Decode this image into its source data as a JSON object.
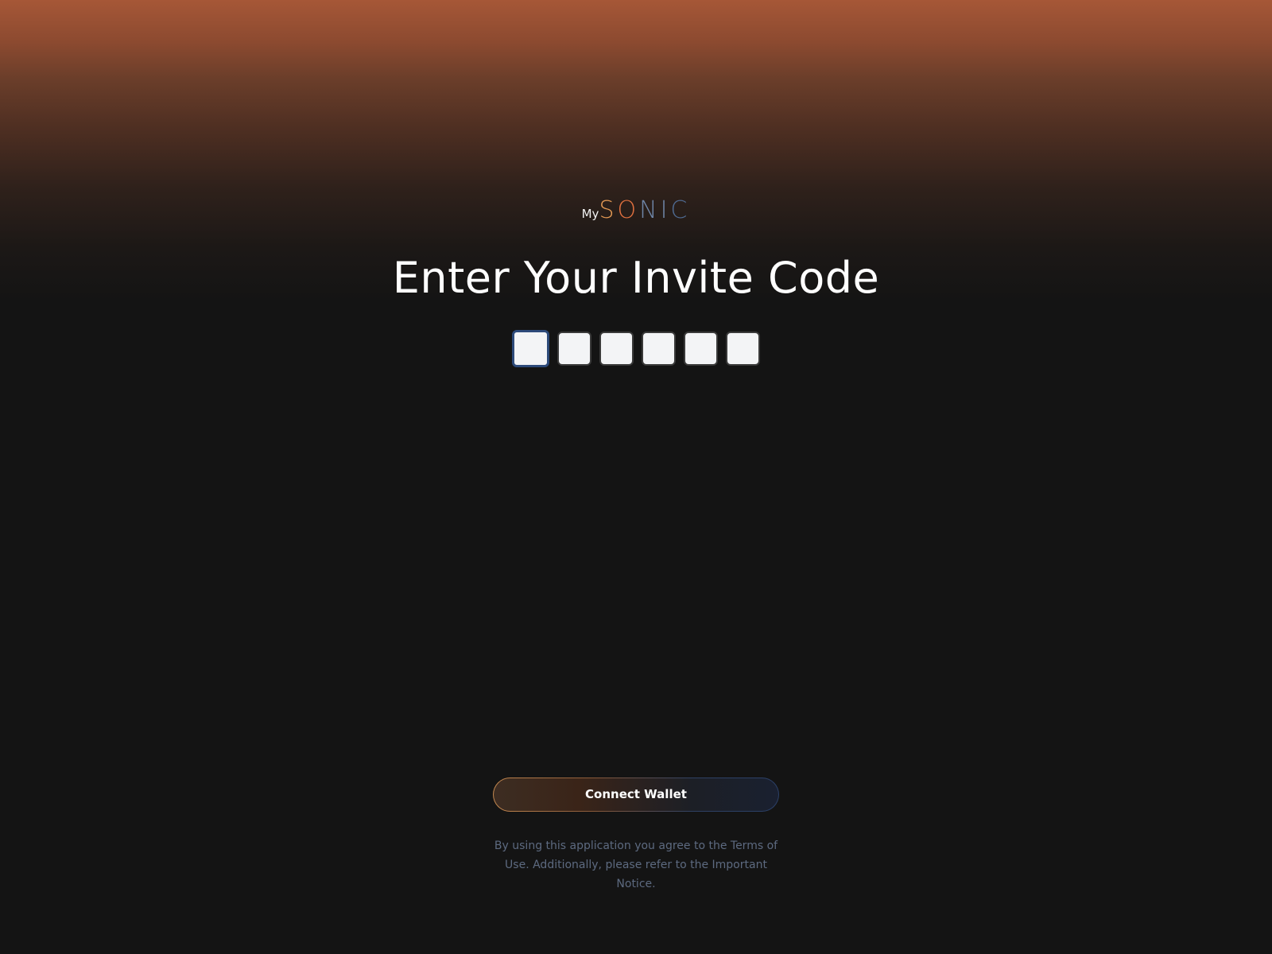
{
  "logo": {
    "prefix": "My",
    "letters": [
      "S",
      "O",
      "N",
      "I",
      "C"
    ]
  },
  "title": "Enter Your Invite Code",
  "invite_code": {
    "digits": [
      "",
      "",
      "",
      "",
      "",
      ""
    ]
  },
  "connect_button": {
    "label": "Connect Wallet"
  },
  "legal": {
    "text": "By using this application you agree to the Terms of Use. Additionally, please refer to the Important Notice."
  },
  "colors": {
    "background": "#141414",
    "gradient_top": "#a65737",
    "logo_orange": "#e59a54",
    "logo_blue": "#4f6a91",
    "input_focus_border": "#2d4a7a",
    "legal_text": "#5d6a80"
  }
}
